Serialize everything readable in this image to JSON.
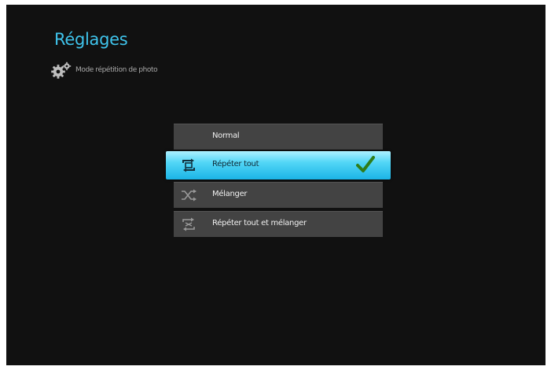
{
  "header": {
    "title": "Réglages",
    "breadcrumb": "Mode répétition de photo",
    "breadcrumb_icon": "gears-icon"
  },
  "menu": {
    "selected_index": 1,
    "items": [
      {
        "label": "Normal",
        "icon": "none"
      },
      {
        "label": "Répéter tout",
        "icon": "repeat-all-icon"
      },
      {
        "label": "Mélanger",
        "icon": "shuffle-icon"
      },
      {
        "label": "Répéter tout et mélanger",
        "icon": "repeat-shuffle-icon"
      }
    ]
  },
  "colors": {
    "title": "#3fc4ec",
    "selection": "#1bb4e6",
    "checkmark": "#2f7d1a"
  }
}
